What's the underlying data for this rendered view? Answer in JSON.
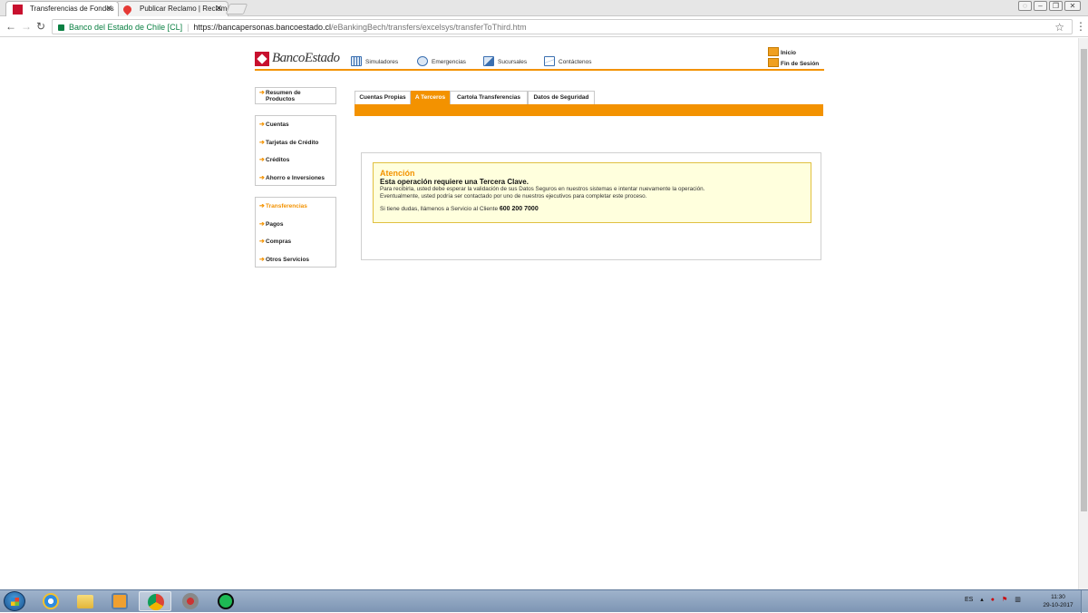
{
  "browser": {
    "tabs": [
      {
        "title": "Transferencias de Fondos",
        "active": true
      },
      {
        "title": "Publicar Reclamo | Reclamos",
        "active": false
      }
    ],
    "address": {
      "secure_label": "Banco del Estado de Chile [CL]",
      "url_host": "https://bancapersonas.bancoestado.cl",
      "url_path": "/eBankingBech/transfers/excelsys/transferToThird.htm"
    }
  },
  "header": {
    "logo_text": "BancoEstado",
    "nav": [
      "Simuladores",
      "Emergencias",
      "Sucursales",
      "Contáctenos"
    ],
    "inicio": "Inicio",
    "fin_sesion": "Fin de Sesión",
    "accent_color": "#f39200",
    "brand_red": "#c8102e"
  },
  "sidebar": {
    "group1": [
      "Resumen de",
      "Productos"
    ],
    "group2": [
      "Cuentas",
      "Tarjetas de Crédito",
      "Créditos",
      "Ahorro e Inversiones"
    ],
    "group3": [
      "Transferencias",
      "Pagos",
      "Compras",
      "Otros Servicios"
    ]
  },
  "tabs": [
    "Cuentas Propias",
    "A Terceros",
    "Cartola Transferencias",
    "Datos de Seguridad"
  ],
  "alert": {
    "title": "Atención",
    "subtitle": "Esta operación requiere una Tercera Clave.",
    "line1": "Para recibirla, usted debe esperar la validación de sus Datos Seguros en nuestros sistemas e intentar nuevamente la operación.",
    "line2": "Eventualmente, usted podría ser contactado por uno de nuestros ejecutivos para completar este proceso.",
    "help_prefix": "Si tiene dudas, llámenos a Servicio al Cliente",
    "phone": "600 200 7000"
  },
  "taskbar": {
    "language": "ES",
    "time": "11:30",
    "date": "29-10-2017"
  }
}
